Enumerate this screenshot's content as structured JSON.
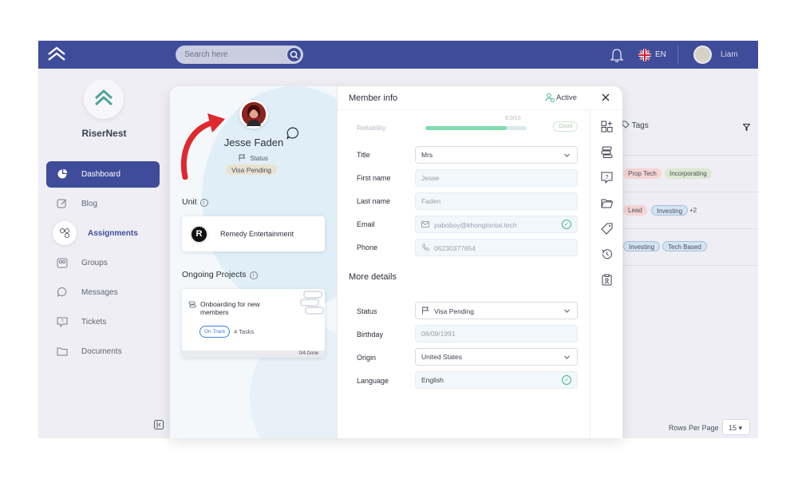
{
  "topbar": {
    "search_placeholder": "Search here",
    "language": "EN",
    "user_name": "Liam"
  },
  "sidebar": {
    "brand": "RiserNest",
    "items": [
      {
        "label": "Dashboard",
        "icon": "pie-chart-icon"
      },
      {
        "label": "Blog",
        "icon": "edit-icon"
      },
      {
        "label": "Assignments",
        "icon": "link-icon"
      },
      {
        "label": "Groups",
        "icon": "groups-icon"
      },
      {
        "label": "Messages",
        "icon": "message-icon"
      },
      {
        "label": "Tickets",
        "icon": "ticket-icon"
      },
      {
        "label": "Documents",
        "icon": "folder-icon"
      }
    ]
  },
  "background_table": {
    "tags_header": "Tags",
    "rows": [
      {
        "tags": [
          "Prop Tech",
          "Incorporating"
        ]
      },
      {
        "tags": [
          "Lead",
          "Investing"
        ],
        "extra": "+2"
      },
      {
        "tags": [
          "Investing",
          "Tech Based"
        ]
      }
    ],
    "rows_per_page_label": "Rows Per Page",
    "rows_per_page_value": "15 ▾"
  },
  "profile": {
    "name": "Jesse Faden",
    "status_label": "Status",
    "status_value": "Visa Pending",
    "unit_title": "Unit",
    "unit_name": "Remedy Entertainment",
    "unit_logo_letter": "R",
    "projects_title": "Ongoing Projects",
    "project": {
      "title": "Onboarding for new members",
      "status": "On Track",
      "tasks": "4 Tasks",
      "progress": "0/4 Done"
    }
  },
  "member_info": {
    "title": "Member info",
    "active_label": "Active",
    "reliability_label": "Reliability",
    "reliability_value": "8.0/10",
    "reliability_fraction": 0.8,
    "reliability_badge": "Good",
    "fields": {
      "title_label": "Title",
      "title_value": "Mrs",
      "first_label": "First name",
      "first_value": "Jesse",
      "last_label": "Last name",
      "last_value": "Faden",
      "email_label": "Email",
      "email_value": "paboboy@khongtontai.tech",
      "phone_label": "Phone",
      "phone_value": "06230377654"
    },
    "more_details_title": "More details",
    "details": {
      "status_label": "Status",
      "status_value": "Visa Pending",
      "birthday_label": "Birthday",
      "birthday_value": "06/09/1991",
      "origin_label": "Origin",
      "origin_value": "United States",
      "language_label": "Language",
      "language_value": "English"
    }
  },
  "colors": {
    "primary": "#3f4c9a",
    "success": "#42b883",
    "accent_red": "#e0282f",
    "on_track": "#3b7ed3"
  }
}
